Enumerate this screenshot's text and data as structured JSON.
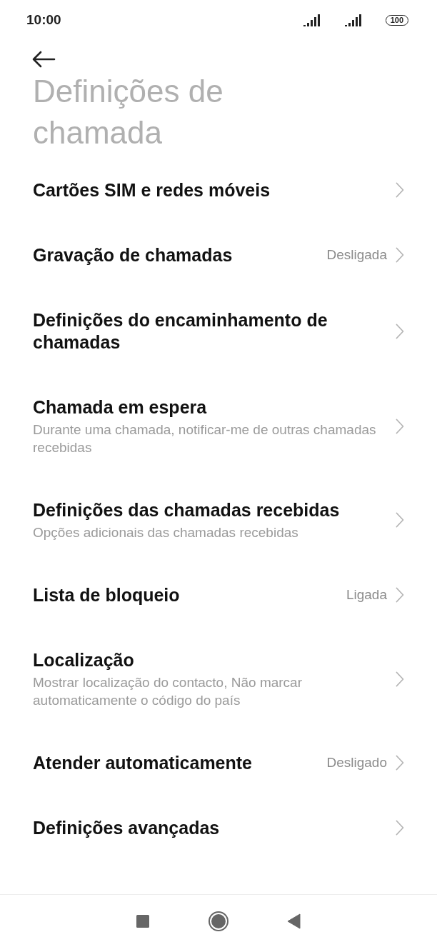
{
  "status_bar": {
    "time": "10:00",
    "battery": "100"
  },
  "title": "Definições de chamada",
  "items": [
    {
      "label": "Cartões SIM e redes móveis"
    },
    {
      "label": "Gravação de chamadas",
      "value": "Desligada"
    },
    {
      "label": "Definições do encaminhamento de chamadas"
    },
    {
      "label": "Chamada em espera",
      "description": "Durante uma chamada, notificar-me de outras chamadas recebidas"
    },
    {
      "label": "Definições das chamadas recebidas",
      "description": "Opções adicionais das chamadas recebidas"
    },
    {
      "label": "Lista de bloqueio",
      "value": "Ligada"
    },
    {
      "label": "Localização",
      "description": "Mostrar localização do contacto, Não marcar automaticamente o código do país"
    },
    {
      "label": "Atender automaticamente",
      "value": "Desligado"
    },
    {
      "label": "Definições avançadas"
    }
  ]
}
